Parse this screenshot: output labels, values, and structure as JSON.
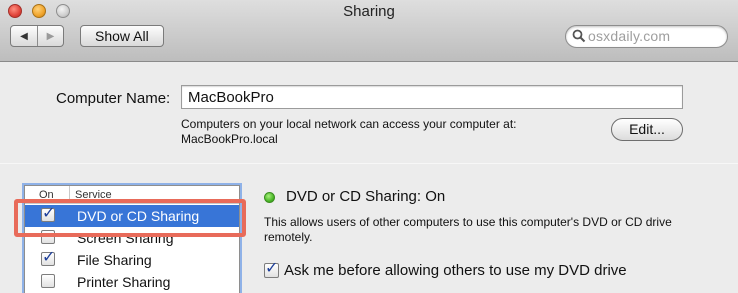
{
  "window": {
    "title": "Sharing"
  },
  "toolbar": {
    "back_icon": "◀",
    "forward_icon": "▶",
    "show_all_label": "Show All",
    "search_text": "osxdaily.com"
  },
  "computer_name": {
    "label": "Computer Name:",
    "value": "MacBookPro",
    "description_line1": "Computers on your local network can access your computer at:",
    "description_line2": "MacBookPro.local",
    "edit_label": "Edit..."
  },
  "services": {
    "header_on": "On",
    "header_service": "Service",
    "items": [
      {
        "label": "DVD or CD Sharing",
        "checked": true,
        "selected": true
      },
      {
        "label": "Screen Sharing",
        "checked": false,
        "selected": false
      },
      {
        "label": "File Sharing",
        "checked": true,
        "selected": false
      },
      {
        "label": "Printer Sharing",
        "checked": false,
        "selected": false
      }
    ]
  },
  "detail": {
    "status": "DVD or CD Sharing: On",
    "status_color": "#4cb829",
    "description": "This allows users of other computers to use this computer's DVD or CD drive remotely.",
    "ask_label": "Ask me before allowing others to use my DVD drive",
    "ask_checked": true
  },
  "colors": {
    "selection": "#3875d7",
    "annotation_box": "#e86b5a"
  }
}
